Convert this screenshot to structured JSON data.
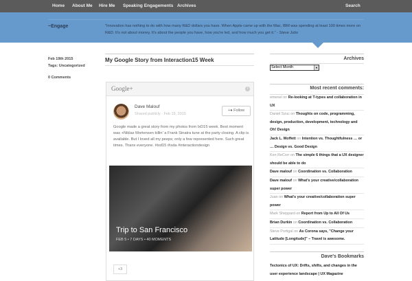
{
  "nav": {
    "items": [
      "Home",
      "About Me",
      "Hire Me",
      "Speaking Engagements",
      "Archives"
    ],
    "search": "Search"
  },
  "header": {
    "site": "~Engage",
    "quote": "\"Innovation has nothing to do with how many R&D dollars you have. When Apple came up with the Mac, IBM was spending at least 100 times more on R&D. It's not about money. It's about the people you have, how you're led, and how much you get it.\" - ",
    "quote_author": "Steve Jobs"
  },
  "post": {
    "date": "Feb 19th 2015",
    "tags_label": "Tags:",
    "tags": "Uncategorized",
    "comments": "0 Comments",
    "title": "My Google Story from Interaction15 Week"
  },
  "gplus": {
    "logo": "Google+",
    "info": "i",
    "author": "Dave Malouf",
    "shared": "Shared publicly  ·  Feb 19, 2015",
    "follow": "Follow",
    "text": "Google made a great story from my photos from IxD15 week. Best moment was +Niklas Mortensen killin' a Frank Sinatra tune at the party closing. A clip is available. But I loved all my peeps; only a few represented here. Such great times. Thanx everyone. #ixd15  #ixda #interactiondesign",
    "story_title": "Trip to San Francisco",
    "story_meta": "FEB 5 • 7 DAYS  •  40 MOMENTS",
    "plus": "+3"
  },
  "sidebar": {
    "archives_title": "Archives",
    "select": "Select Month",
    "comments_title": "Most recent comments:",
    "comments": [
      {
        "author": "emenel",
        "on": "on",
        "post": "Re-looking at T-types and collaboration in UX",
        "bold": false
      },
      {
        "author": "Daniel Szuc",
        "on": "on",
        "post": "Thoughts on code, programming, design, production, development, technology and Oh! Design",
        "bold": false
      },
      {
        "author": "Jack L. Moffett",
        "on": "on",
        "post": "Intention vs. Thoughtfulness … or … Design vs. Good Design",
        "bold": true
      },
      {
        "author": "Ken ReCorr",
        "on": "on",
        "post": "The simple 6 things that a UX designer should be able to do",
        "bold": false
      },
      {
        "author": "Dave malouf",
        "on": "on",
        "post": "Coordination vs. Collaboration",
        "bold": true
      },
      {
        "author": "Dave malouf",
        "on": "on",
        "post": "What's your creative/collaboration super power",
        "bold": true
      },
      {
        "author": "Juan",
        "on": "on",
        "post": "What's your creative/collaboration super power",
        "bold": false
      },
      {
        "author": "Mark Sheppard",
        "on": "on",
        "post": "Report from Up to All Of Us",
        "bold": false
      },
      {
        "author": "Brian Durkin",
        "on": "on",
        "post": "Coordination vs. Collaboration",
        "bold": true
      },
      {
        "author": "Steve Portigal",
        "on": "on",
        "post": "As Corona says, \"Change your Latitude [Longitude]\" – Travel is awesome.",
        "bold": false
      }
    ],
    "bookmarks_title": "Dave's Bookmarks",
    "bookmark": "Tectonics of UX: Drifts, shifts, and changes in the user experience landscape | UX Magazine"
  }
}
